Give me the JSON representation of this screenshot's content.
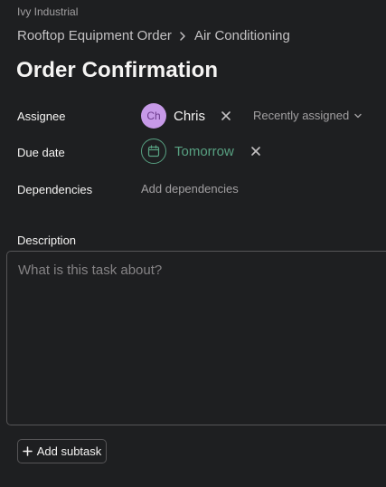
{
  "workspace": "Ivy Industrial",
  "breadcrumb": {
    "items": [
      "Rooftop Equipment Order",
      "Air Conditioning"
    ]
  },
  "title": "Order Confirmation",
  "fields": {
    "assignee": {
      "label": "Assignee",
      "initials": "Ch",
      "name": "Chris",
      "recent_label": "Recently assigned",
      "avatar_color": "#c79ae8"
    },
    "due_date": {
      "label": "Due date",
      "value": "Tomorrow",
      "color": "#58a182"
    },
    "dependencies": {
      "label": "Dependencies",
      "action": "Add dependencies"
    }
  },
  "description": {
    "label": "Description",
    "placeholder": "What is this task about?"
  },
  "add_subtask_label": "Add subtask",
  "icons": {
    "breadcrumb_separator": "chevron-right-icon",
    "clear": "close-icon",
    "recent_dropdown": "chevron-down-icon",
    "due_date": "calendar-icon",
    "add_subtask": "plus-icon"
  }
}
